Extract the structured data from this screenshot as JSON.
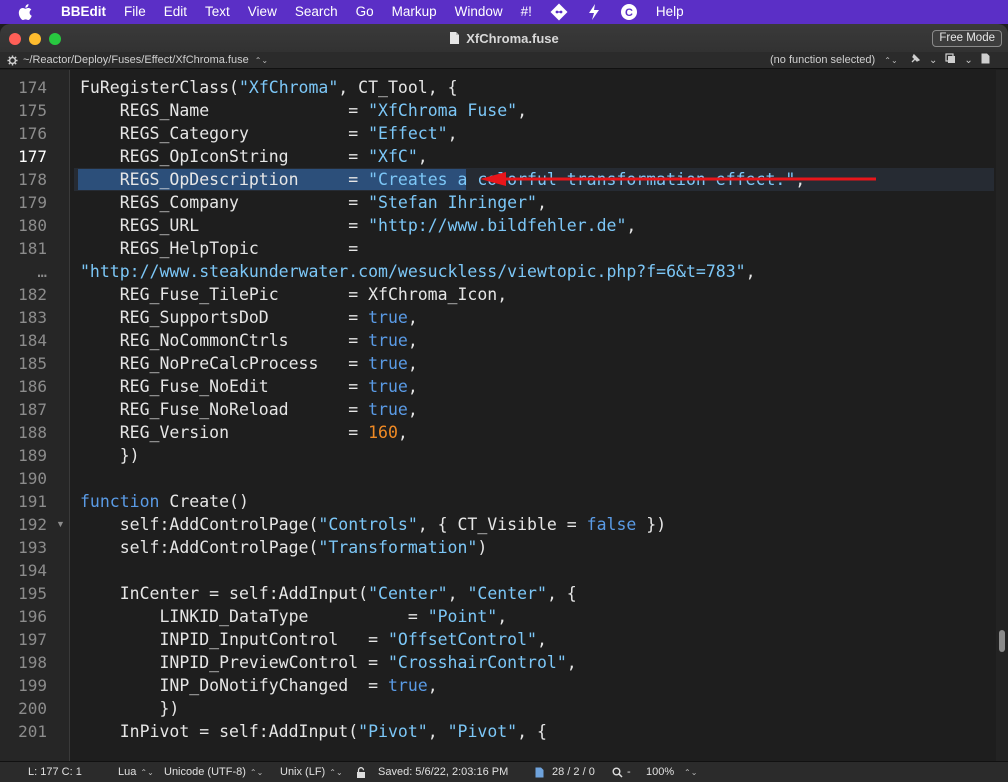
{
  "menubar": {
    "app_name": "BBEdit",
    "items": [
      "File",
      "Edit",
      "Text",
      "View",
      "Search",
      "Go",
      "Markup",
      "Window",
      "#!"
    ],
    "help": "Help"
  },
  "window": {
    "title": "XfChroma.fuse",
    "free_mode": "Free Mode"
  },
  "navbar": {
    "path": "~/Reactor/Deploy/Fuses/Effect/XfChroma.fuse",
    "function_popup": "(no function selected)"
  },
  "code": {
    "line_numbers": [
      "174",
      "175",
      "176",
      "177",
      "178",
      "179",
      "180",
      "181",
      "…",
      "182",
      "183",
      "184",
      "185",
      "186",
      "187",
      "188",
      "189",
      "190",
      "191",
      "192",
      "193",
      "194",
      "195",
      "196",
      "197",
      "198",
      "199",
      "200",
      "201"
    ],
    "current_line": "177"
  },
  "statusbar": {
    "position": "L: 177 C: 1",
    "language": "Lua",
    "encoding": "Unicode (UTF-8)",
    "line_endings": "Unix (LF)",
    "saved": "Saved: 5/6/22, 2:03:16 PM",
    "counts": "28 / 2 / 0",
    "zoom": "100%"
  },
  "colors": {
    "menubar_bg": "#5b2fc6",
    "string": "#7cc7f7",
    "keyword": "#5a9be6",
    "number": "#f08a24",
    "annotation_arrow": "#e8161b",
    "selection": "#2c4f7a"
  }
}
